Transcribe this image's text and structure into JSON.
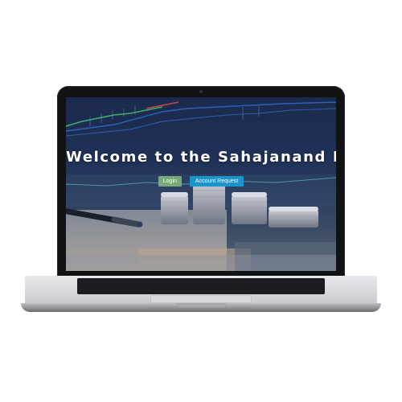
{
  "hero": {
    "title": "Welcome to the Sahajanand Bank"
  },
  "actions": {
    "login_label": "Login",
    "account_request_label": "Account Request"
  },
  "colors": {
    "login_button": "#7aa879",
    "account_button": "#1b94c9",
    "cursor": "#f0b429"
  }
}
